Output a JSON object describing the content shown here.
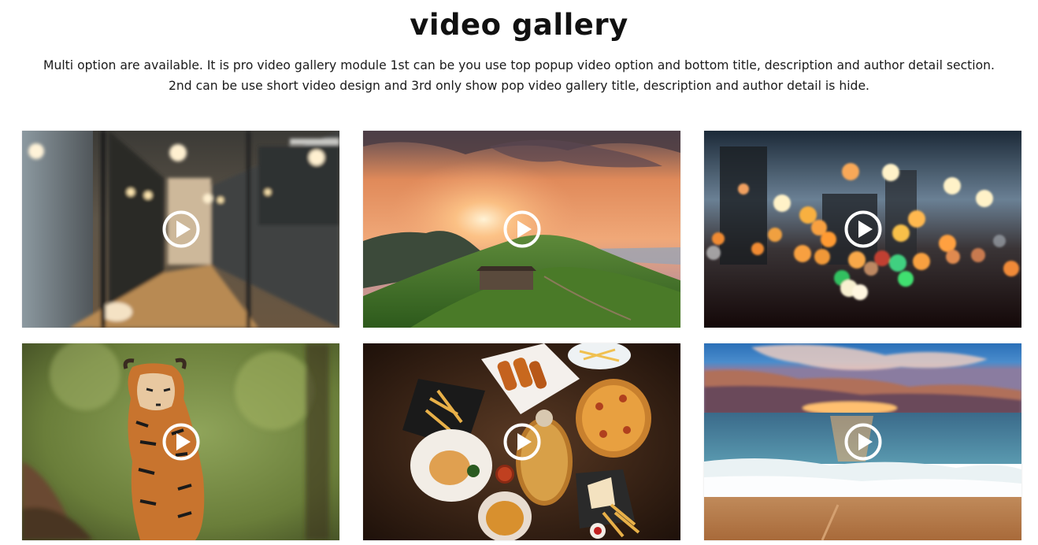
{
  "header": {
    "title": "video gallery",
    "description_line1": "Multi option are available. It is pro video gallery module 1st can be you use top popup video option and bottom title, description and author detail section.",
    "description_line2": "2nd can be use short video design and 3rd only show pop video gallery title, description and author detail is hide."
  },
  "gallery": {
    "items": [
      {
        "scene": "office corridor",
        "icon": "play-icon"
      },
      {
        "scene": "mountain sunset",
        "icon": "play-icon"
      },
      {
        "scene": "city bokeh lights",
        "icon": "play-icon"
      },
      {
        "scene": "tiger walking",
        "icon": "play-icon"
      },
      {
        "scene": "food table",
        "icon": "play-icon"
      },
      {
        "scene": "beach sunset",
        "icon": "play-icon"
      }
    ]
  }
}
